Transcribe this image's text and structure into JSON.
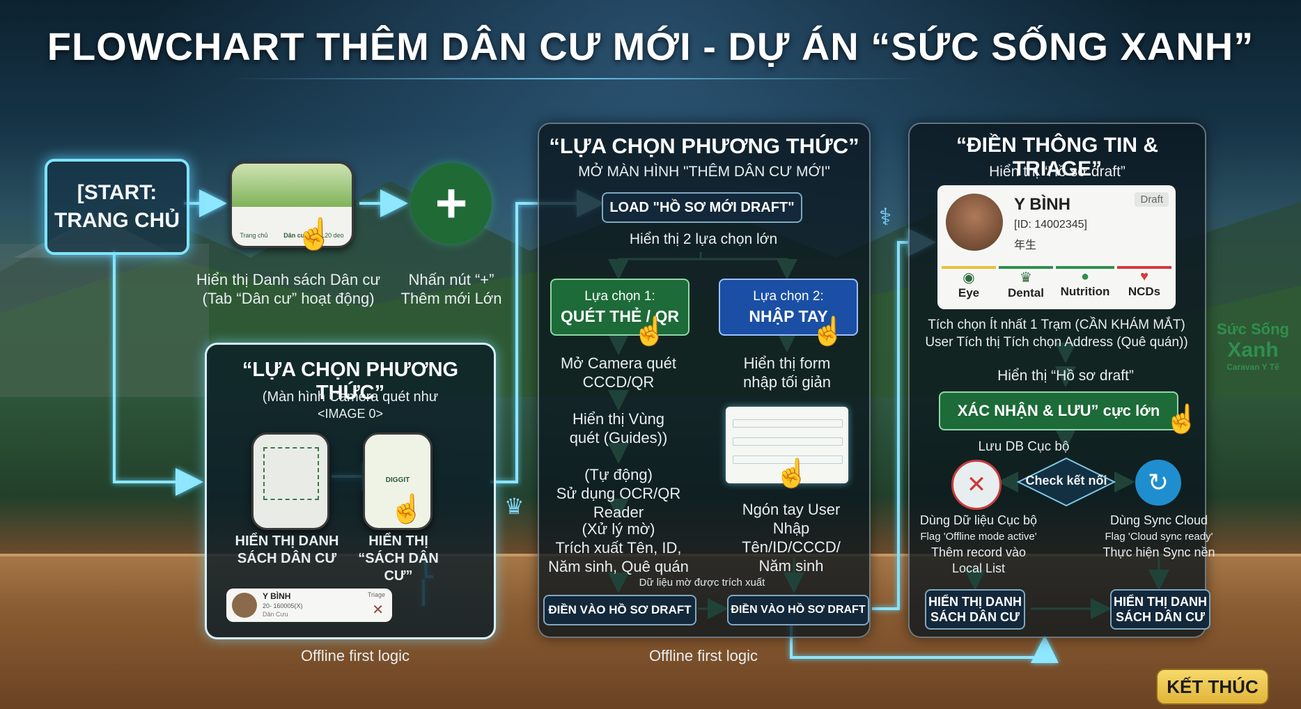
{
  "title": "FLOWCHART THÊM DÂN CƯ MỚI - DỰ ÁN “SỨC SỐNG XANH”",
  "start": {
    "line1": "[START:",
    "line2": "TRANG CHỦ"
  },
  "home": {
    "phone_tabs": [
      "Trang chủ",
      "Dân cư",
      "L20 deo"
    ],
    "caption1": "Hiển thị Danh sách Dân cư",
    "caption2": "(Tab “Dân cư” hoạt động)",
    "plus_caption1": "Nhấn nút “+”",
    "plus_caption2": "Thêm mới Lớn"
  },
  "panel_left": {
    "title": "“LỰA CHỌN PHƯƠNG THỨC”",
    "sub1": "(Màn hình Camera quét như",
    "sub2": "<IMAGE 0>",
    "label_a1": "HIỂN THỊ DANH",
    "label_a2": "SÁCH DÂN CƯ",
    "label_b1": "HIỂN THỊ",
    "label_b2": "“SÁCH DÂN CƯ”",
    "card_name": "Y BÌNH",
    "card_id": "20- 160005(X)",
    "card_tag": "Triage",
    "card_extra": "Dân Cưu",
    "phone_text": "DIGGIT",
    "footer": "Offline first logic"
  },
  "panel_mid": {
    "title": "“LỰA CHỌN PHƯƠNG THỨC”",
    "sub": "MỞ MÀN HÌNH \"THÊM DÂN CƯ MỚI\"",
    "load": "LOAD \"HỒ SƠ MỚI DRAFT\"",
    "show2": "Hiển thị 2 lựa chọn lớn",
    "opt1_small": "Lựa chọn 1:",
    "opt1_big": "QUÉT THẺ / QR",
    "opt2_small": "Lựa chọn 2:",
    "opt2_big": "NHẬP TAY",
    "l1": "Mở Camera quét",
    "l2": "CCCD/QR",
    "l3": "Hiển thị Vùng",
    "l4": "quét (Guides))",
    "l5": "(Tự động)",
    "l6": "Sử dụng OCR/QR Reader",
    "l7": "(Xử lý mờ)",
    "l8": "Trích xuất Tên, ID,",
    "l9": "Năm sinh, Quê quán",
    "l10": "Dữ liệu mờ được trích xuất",
    "r1": "Hiển thị form",
    "r2": "nhập tối giản",
    "r3": "Ngón tay User",
    "r4": "Nhập Tên/ID/CCCD/",
    "r5": "Năm sinh",
    "fill1": "ĐIỀN VÀO HỒ SƠ DRAFT",
    "fill2": "ĐIỀN VÀO HỒ SƠ DRAFT",
    "footer": "Offline first logic"
  },
  "panel_right": {
    "title": "“ĐIỀN THÔNG TIN & TRIAGE”",
    "sub": "Hiển thị “Hồ sơ draft”",
    "name": "Y BÌNH",
    "id": "[ID: 14002345]",
    "year": "年生",
    "draft": "Draft",
    "triage": [
      {
        "label": "Eye",
        "color": "#e6c23a",
        "icon": "eye-icon"
      },
      {
        "label": "Dental",
        "color": "#2f8f4e",
        "icon": "tooth-icon"
      },
      {
        "label": "Nutrition",
        "color": "#2f8f4e",
        "icon": "apple-icon"
      },
      {
        "label": "NCDs",
        "color": "#d33a3a",
        "icon": "heart-icon"
      }
    ],
    "t1": "Tích chọn Ít nhất 1 Trạm (CẦN KHÁM MẮT)",
    "t2": "User Tích thị Tích chọn Address (Quê quán))",
    "t3": "Hiển thị “Hồ sơ draft”",
    "confirm": "XÁC NHẬN & LƯU” cực lớn",
    "localdb": "Lưu DB Cục bộ",
    "check": "Check kết nối",
    "left1": "Dùng Dữ liệu Cục bộ",
    "left2": "Flag 'Offline mode active'",
    "left3": "Thêm record vào",
    "left4": "Local List",
    "right1": "Dùng Sync Cloud",
    "right2": "Flag 'Cloud sync ready'",
    "right3": "Thực hiện Sync nền",
    "end_left1": "HIỂN THỊ DANH",
    "end_left2": "SÁCH DÂN CƯ",
    "end_right1": "HIỂN THỊ DANH",
    "end_right2": "SÁCH DÂN CƯ"
  },
  "banner": {
    "line1": "Sức Sống",
    "line2": "Xanh",
    "line3": "Caravan Y Tế"
  },
  "end": "KẾT THÚC"
}
